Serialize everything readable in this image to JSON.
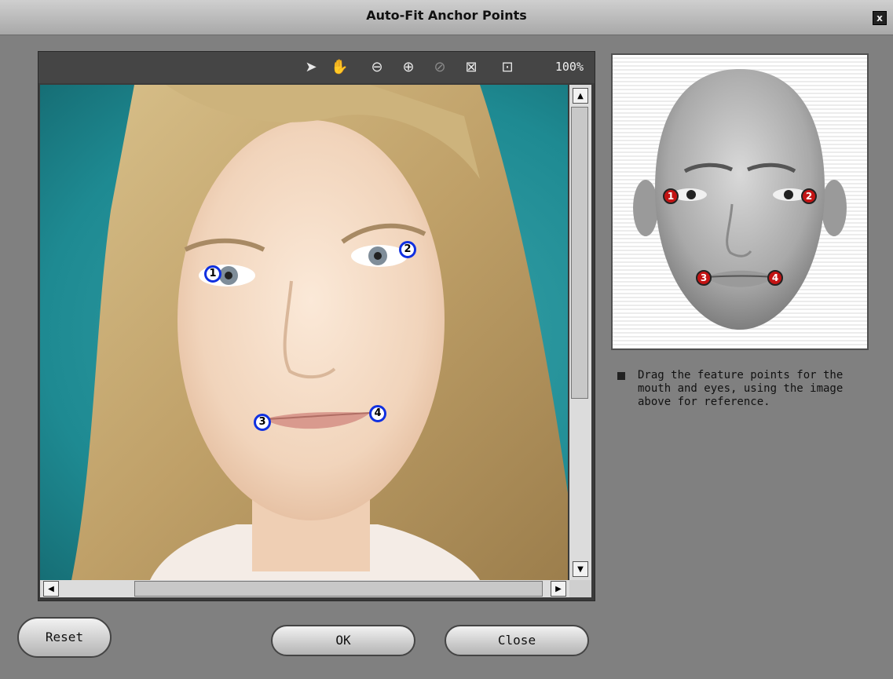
{
  "window": {
    "title": "Auto-Fit Anchor Points",
    "close_label": "x"
  },
  "toolbar": {
    "tools": [
      {
        "icon": "select-arrow-icon",
        "glyph": "➤"
      },
      {
        "icon": "pan-hand-icon",
        "glyph": "✋"
      },
      {
        "icon": "zoom-out-icon",
        "glyph": "⊖"
      },
      {
        "icon": "zoom-in-icon",
        "glyph": "⊕"
      },
      {
        "icon": "disabled-circle-icon",
        "glyph": "⊘"
      },
      {
        "icon": "fit-view-icon",
        "glyph": "⊠"
      },
      {
        "icon": "center-zoom-icon",
        "glyph": "⊡"
      }
    ],
    "zoom": "100%"
  },
  "markers": [
    "1",
    "2",
    "3",
    "4"
  ],
  "reference": {
    "markers": [
      "1",
      "2",
      "3",
      "4"
    ]
  },
  "instructions": "Drag the feature points for the mouth and eyes, using the image above for reference.",
  "buttons": {
    "reset": "Reset",
    "ok": "OK",
    "close": "Close"
  },
  "scrollbar_glyphs": {
    "up": "▲",
    "down": "▼",
    "left": "◀",
    "right": "▶"
  },
  "colors": {
    "marker_border": "#1030e0",
    "ref_marker": "#c41414",
    "background": "#808080"
  }
}
